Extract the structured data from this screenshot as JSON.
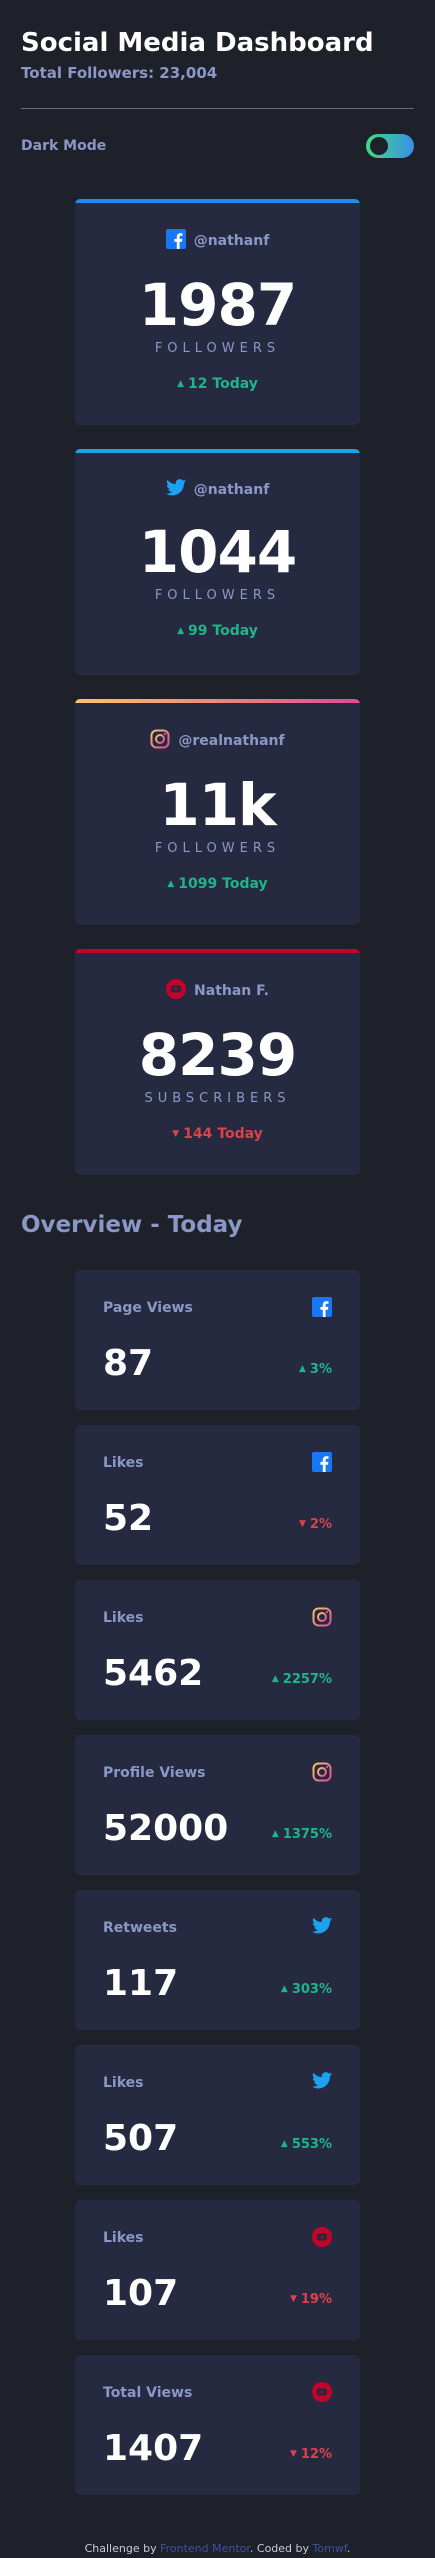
{
  "header": {
    "title": "Social Media Dashboard",
    "total_followers": "Total Followers: 23,004",
    "dark_mode_label": "Dark Mode",
    "dark_mode_on": true
  },
  "colors": {
    "facebook": "#1877f2",
    "twitter": "#1da1f2",
    "instagram_start": "#fdc468",
    "instagram_end": "#df4996",
    "youtube": "#c4032a",
    "up": "#1eb589",
    "down": "#dc414c"
  },
  "followers": [
    {
      "platform": "facebook",
      "icon": "facebook-icon",
      "handle": "@nathanf",
      "count": "1987",
      "label": "FOLLOWERS",
      "delta": "12 Today",
      "trend": "up"
    },
    {
      "platform": "twitter",
      "icon": "twitter-icon",
      "handle": "@nathanf",
      "count": "1044",
      "label": "FOLLOWERS",
      "delta": "99 Today",
      "trend": "up"
    },
    {
      "platform": "instagram",
      "icon": "instagram-icon",
      "handle": "@realnathanf",
      "count": "11k",
      "label": "FOLLOWERS",
      "delta": "1099 Today",
      "trend": "up"
    },
    {
      "platform": "youtube",
      "icon": "youtube-icon",
      "handle": "Nathan F.",
      "count": "8239",
      "label": "SUBSCRIBERS",
      "delta": "144 Today",
      "trend": "down"
    }
  ],
  "overview": {
    "title": "Overview - Today",
    "items": [
      {
        "platform": "facebook",
        "metric": "Page Views",
        "count": "87",
        "delta": "3%",
        "trend": "up"
      },
      {
        "platform": "facebook",
        "metric": "Likes",
        "count": "52",
        "delta": "2%",
        "trend": "down"
      },
      {
        "platform": "instagram",
        "metric": "Likes",
        "count": "5462",
        "delta": "2257%",
        "trend": "up"
      },
      {
        "platform": "instagram",
        "metric": "Profile Views",
        "count": "52000",
        "delta": "1375%",
        "trend": "up"
      },
      {
        "platform": "twitter",
        "metric": "Retweets",
        "count": "117",
        "delta": "303%",
        "trend": "up"
      },
      {
        "platform": "twitter",
        "metric": "Likes",
        "count": "507",
        "delta": "553%",
        "trend": "up"
      },
      {
        "platform": "youtube",
        "metric": "Likes",
        "count": "107",
        "delta": "19%",
        "trend": "down"
      },
      {
        "platform": "youtube",
        "metric": "Total Views",
        "count": "1407",
        "delta": "12%",
        "trend": "down"
      }
    ]
  },
  "footer": {
    "prefix": "Challenge by ",
    "link1": "Frontend Mentor",
    "middle": ". Coded by ",
    "link2": "Tomwf",
    "suffix": "."
  }
}
